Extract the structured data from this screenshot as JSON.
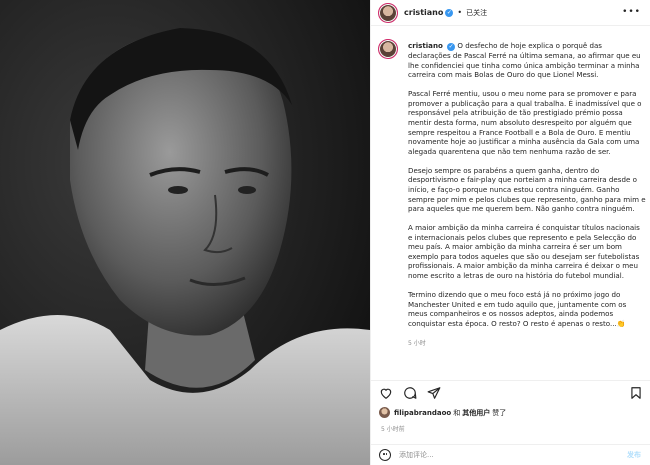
{
  "header": {
    "username": "cristiano",
    "verified_mark": "✓",
    "separator": "•",
    "follow_status": "已关注",
    "more_label": "•••"
  },
  "caption": {
    "username": "cristiano",
    "paragraphs": [
      "O desfecho de hoje explica o porquê das declarações de Pascal Ferré na última semana, ao afirmar que eu lhe confidenciei que tinha como única ambição terminar a minha carreira com mais Bolas de Ouro do que Lionel Messi.",
      "Pascal Ferré mentiu, usou o meu nome para se promover e para promover a publicação para a qual trabalha. É inadmissível que o responsável pela atribuição de tão prestigiado prémio possa mentir desta forma, num absoluto desrespeito por alguém que sempre respeitou a France Football e a Bola de Ouro. E mentiu novamente hoje ao justificar a minha ausência da Gala com uma alegada quarentena que não tem nenhuma razão de ser.",
      "Desejo sempre os parabéns a quem ganha, dentro do desportivismo e fair-play que norteiam a minha carreira desde o início, e faço-o porque nunca estou contra ninguém. Ganho sempre por mim e pelos clubes que represento, ganho para mim e para aqueles que me querem bem. Não ganho contra ninguém.",
      "A maior ambição da minha carreira é conquistar títulos nacionais e internacionais pelos clubes que represento e pela Selecção do meu país. A maior ambição da minha carreira é ser um bom exemplo para todos aqueles que são ou desejam ser futebolistas profissionais. A maior ambição da minha carreira é deixar o meu nome escrito a letras de ouro na história do futebol mundial.",
      "Termino dizendo que o meu foco está já no próximo jogo do Manchester United e em tudo aquilo que, juntamente com os meus companheiros e os nossos adeptos, ainda podemos conquistar esta época. O resto? O resto é apenas o resto...👏"
    ],
    "time": "5 小时"
  },
  "actions": {
    "like_icon": "heart-icon",
    "comment_icon": "comment-icon",
    "share_icon": "paper-plane-icon",
    "save_icon": "bookmark-icon"
  },
  "likes": {
    "user": "filipabrandaoo",
    "connector": "和",
    "others": "其他用户",
    "suffix": "赞了"
  },
  "post_time": "5 小时前",
  "comment": {
    "placeholder": "添加评论...",
    "post_label": "发布"
  }
}
